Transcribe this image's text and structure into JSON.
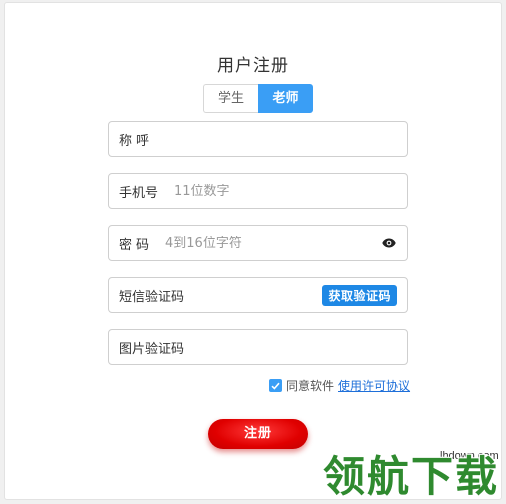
{
  "form": {
    "title": "用户注册",
    "roles": {
      "student": "学生",
      "teacher": "老师",
      "selected": "teacher"
    },
    "fields": {
      "nickname": {
        "label": "称呼",
        "placeholder": ""
      },
      "phone": {
        "label": "手机号",
        "placeholder": "11位数字"
      },
      "password": {
        "label": "密码",
        "placeholder": "4到16位字符"
      },
      "sms_code": {
        "label": "短信验证码",
        "button": "获取验证码"
      },
      "image_code": {
        "label": "图片验证码"
      }
    },
    "agreement": {
      "text": "同意软件",
      "link": "使用许可协议",
      "checked": true
    },
    "submit_label": "注册"
  },
  "watermark": {
    "site": "lhdown.com",
    "logo": "领航下载"
  },
  "colors": {
    "accent": "#3a9ef5",
    "sms_button": "#1e88e5",
    "submit": "#e00000",
    "link": "#1e6fd9"
  }
}
